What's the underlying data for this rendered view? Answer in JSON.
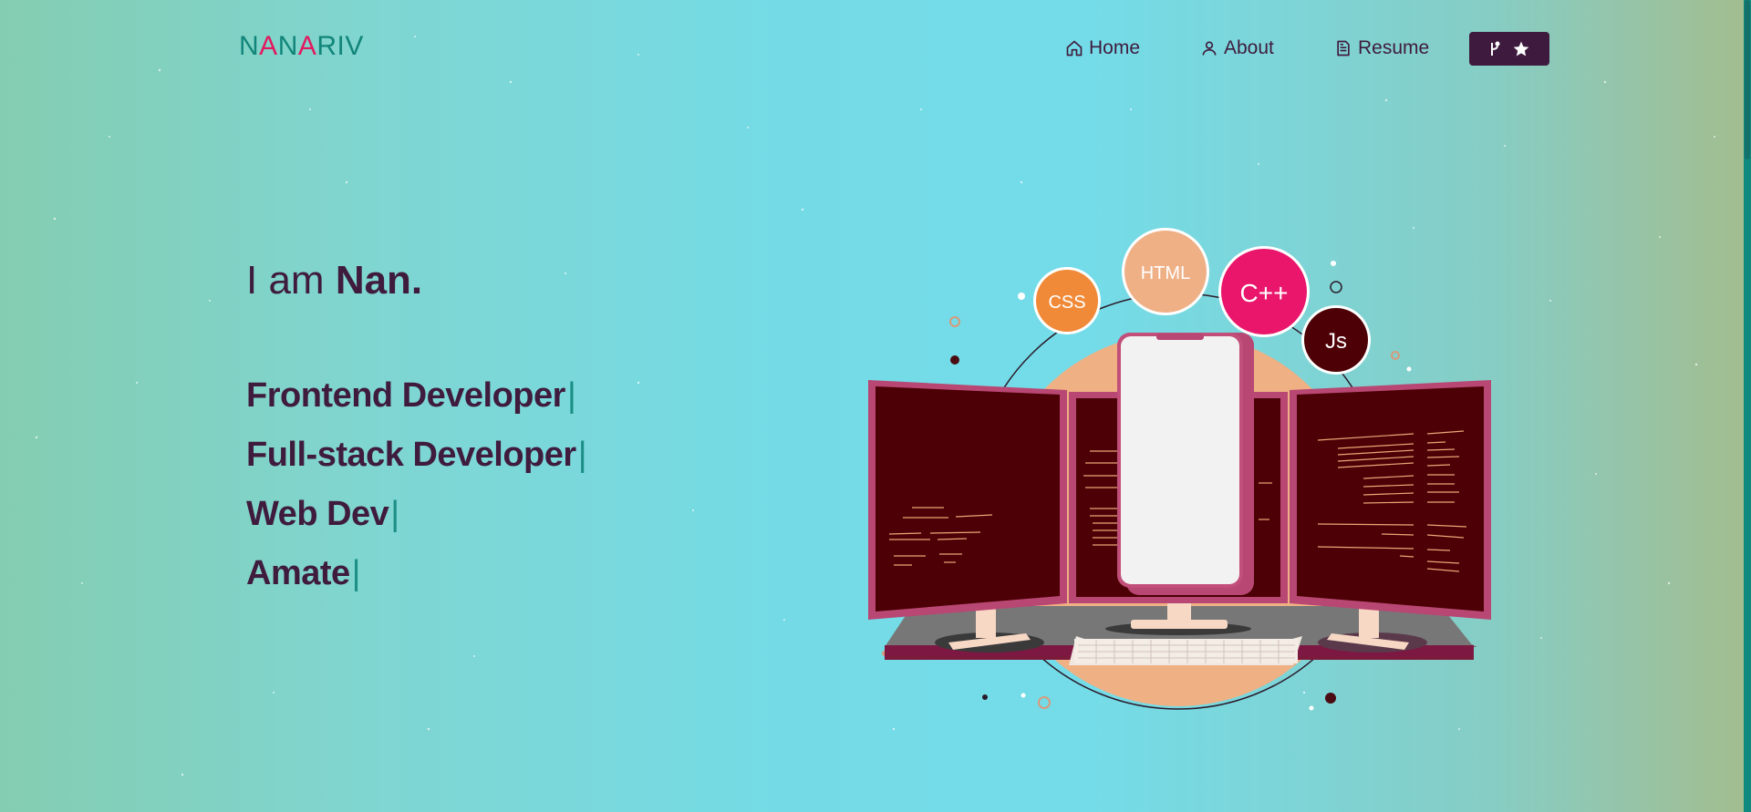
{
  "logo": {
    "letters": [
      "N",
      "A",
      "N",
      "A",
      "R",
      "I",
      "V"
    ]
  },
  "nav": {
    "home": "Home",
    "about": "About",
    "resume": "Resume"
  },
  "hero": {
    "intro_prefix": "I am",
    "name": "Nan.",
    "roles": [
      "Frontend Developer",
      "Full-stack Developer",
      "Web Dev",
      "Amate"
    ],
    "cursor": "|"
  },
  "illustration": {
    "bubbles": [
      "CSS",
      "HTML",
      "C++",
      "Js"
    ]
  },
  "colors": {
    "brand_teal": "#12857a",
    "brand_pink": "#e2195f",
    "text_dark": "#3f1b3d",
    "button_bg": "#3e1b3e"
  },
  "icons": {
    "home": "home-icon",
    "about": "user-icon",
    "resume": "document-icon",
    "fork": "fork-icon",
    "star": "star-icon"
  }
}
